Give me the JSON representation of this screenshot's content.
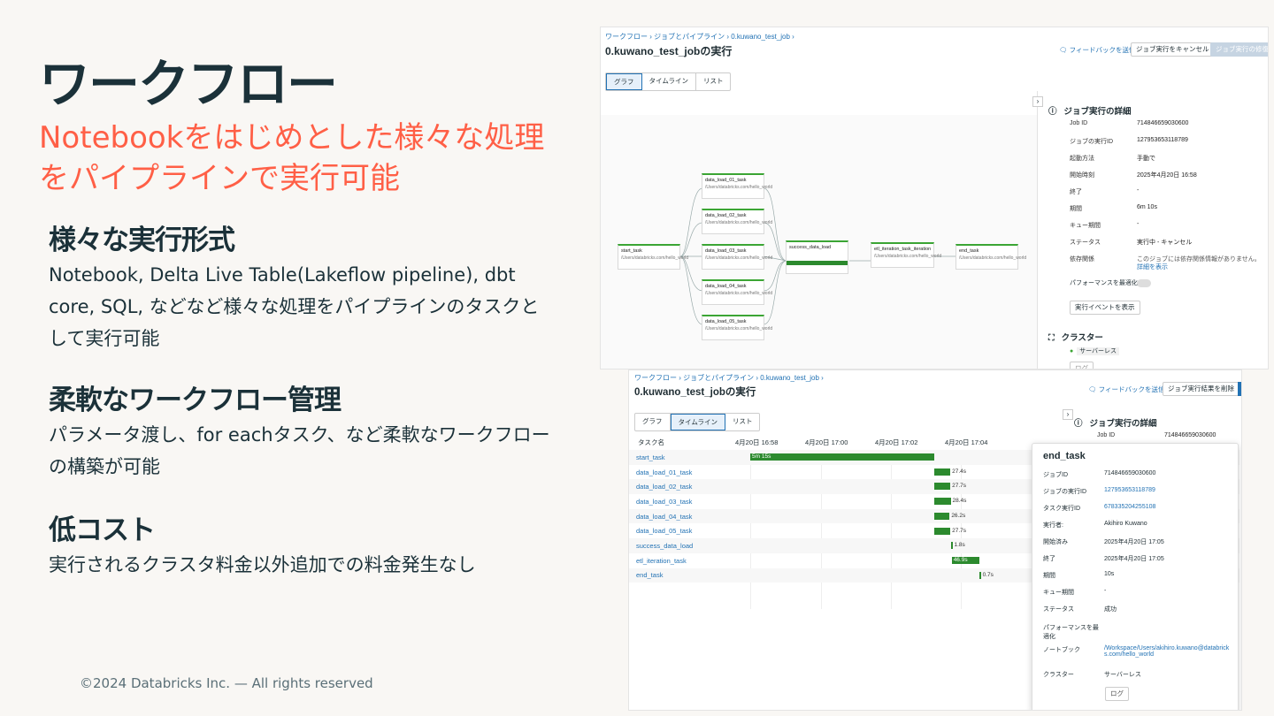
{
  "slide": {
    "title": "ワークフロー",
    "subtitle_l1": "Notebookをはじめとした様々な処理",
    "subtitle_l2": "をパイプラインで実行可能",
    "sections": [
      {
        "title": "様々な実行形式",
        "body": "Notebook, Delta Live Table(Lakeflow pipeline), dbt core, SQL, などなど様々な処理をパイプラインのタスクとして実行可能"
      },
      {
        "title": "柔軟なワークフロー管理",
        "body": "パラメータ渡し、for eachタスク、など柔軟なワークフローの構築が可能"
      },
      {
        "title": "低コスト",
        "body": "実行されるクラスタ料金以外追加での料金発生なし"
      }
    ],
    "footer": "©2024 Databricks Inc. — All rights reserved"
  },
  "shot1": {
    "breadcrumb": [
      "ワークフロー",
      "ジョブとパイプライン",
      "0.kuwano_test_job"
    ],
    "title": "0.kuwano_test_jobの実行",
    "feedback": "フィードバックを送信",
    "cancel": "ジョブ実行をキャンセル",
    "repair": "ジョブ実行の修復",
    "tabs": [
      "グラフ",
      "タイムライン",
      "リスト"
    ],
    "nodes": {
      "start": "start_task",
      "d1": "data_load_01_task",
      "d2": "data_load_02_task",
      "d3": "data_load_03_task",
      "d4": "data_load_04_task",
      "d5": "data_load_05_task",
      "success": "success_data_load",
      "etl": "etl_iteration_task_iteration",
      "end": "end_task"
    },
    "panel": {
      "title": "ジョブ実行の詳細",
      "rows": [
        {
          "k": "Job ID",
          "v": "714846659030600"
        },
        {
          "k": "ジョブの実行ID",
          "v": "127953653118789"
        },
        {
          "k": "起動方法",
          "v": "手動で"
        },
        {
          "k": "開始時刻",
          "v": "2025年4月20日 16:58"
        },
        {
          "k": "終了",
          "v": "-"
        },
        {
          "k": "期間",
          "v": "6m 10s"
        },
        {
          "k": "キュー期間",
          "v": "-"
        },
        {
          "k": "ステータス",
          "v": "実行中 - キャンセル"
        },
        {
          "k": "依存関係",
          "v": "このジョブには依存関係情報がありません。"
        }
      ],
      "detail_link": "詳細を表示",
      "perf": "パフォーマンスを最適化",
      "events_btn": "実行イベントを表示",
      "cluster_title": "クラスター",
      "serverless": "サーバーレス",
      "log": "ログ"
    }
  },
  "shot2": {
    "breadcrumb": [
      "ワークフロー",
      "ジョブとパイプライン",
      "0.kuwano_test_job"
    ],
    "title": "0.kuwano_test_jobの実行",
    "feedback": "フィードバックを送信",
    "delete": "ジョブ実行結果を削除",
    "tabs": [
      "グラフ",
      "タイムライン",
      "リスト"
    ],
    "task_header": "タスク名",
    "times": [
      "4月20日 16:58",
      "4月20日 17:00",
      "4月20日 17:02",
      "4月20日 17:04"
    ],
    "tasks": [
      {
        "name": "start_task",
        "start": 0.0,
        "dur": 5.25,
        "label": "5m 15s"
      },
      {
        "name": "data_load_01_task",
        "start": 5.25,
        "dur": 0.46,
        "label": "27.4s"
      },
      {
        "name": "data_load_02_task",
        "start": 5.25,
        "dur": 0.46,
        "label": "27.7s"
      },
      {
        "name": "data_load_03_task",
        "start": 5.25,
        "dur": 0.47,
        "label": "28.4s"
      },
      {
        "name": "data_load_04_task",
        "start": 5.25,
        "dur": 0.44,
        "label": "26.2s"
      },
      {
        "name": "data_load_05_task",
        "start": 5.25,
        "dur": 0.46,
        "label": "27.7s"
      },
      {
        "name": "success_data_load",
        "start": 5.72,
        "dur": 0.03,
        "label": "1.8s"
      },
      {
        "name": "etl_iteration_task",
        "start": 5.75,
        "dur": 0.78,
        "label": "46.9s"
      },
      {
        "name": "end_task",
        "start": 6.53,
        "dur": 0.01,
        "label": "0.7s"
      }
    ],
    "side_title": "ジョブ実行の詳細",
    "side_jobid_k": "Job ID",
    "side_jobid_v": "714846659030600",
    "popup": {
      "title": "end_task",
      "rows": [
        {
          "k": "ジョブID",
          "v": "714846659030600"
        },
        {
          "k": "ジョブの実行ID",
          "v": "127953653118789"
        },
        {
          "k": "タスク実行ID",
          "v": "678335204255108"
        },
        {
          "k": "実行者:",
          "v": "Akihiro Kuwano"
        },
        {
          "k": "開始済み",
          "v": "2025年4月20日 17:05"
        },
        {
          "k": "終了",
          "v": "2025年4月20日 17:05"
        },
        {
          "k": "期間",
          "v": "10s"
        },
        {
          "k": "キュー期間",
          "v": "-"
        },
        {
          "k": "ステータス",
          "v": "成功"
        },
        {
          "k": "パフォーマンスを最適化",
          "v": ""
        },
        {
          "k": "ノートブック",
          "v": "/Workspace/Users/akihiro.kuwano@databricks.com/hello_world"
        },
        {
          "k": "クラスター",
          "v": "サーバーレス"
        }
      ],
      "log": "ログ"
    }
  },
  "colors": {
    "brand_dark": "#1b3139",
    "accent": "#ff5f46",
    "link": "#2272b4",
    "success": "#3ba534"
  }
}
